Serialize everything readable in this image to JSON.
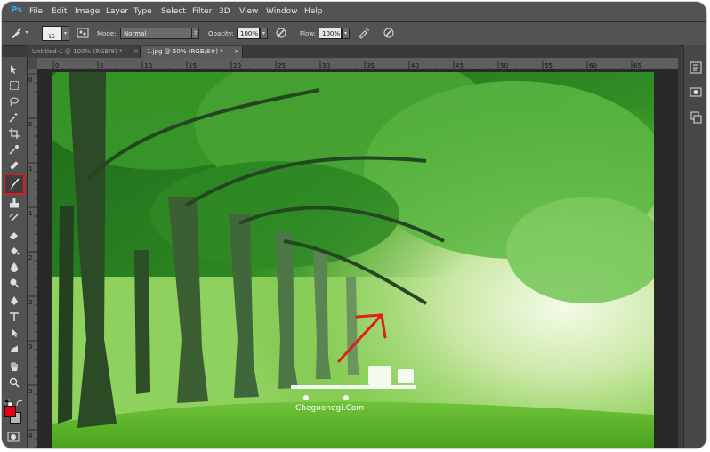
{
  "menubar": {
    "app_icon": "Ps",
    "items": [
      "File",
      "Edit",
      "Image",
      "Layer",
      "Type",
      "Select",
      "Filter",
      "3D",
      "View",
      "Window",
      "Help"
    ]
  },
  "options_bar": {
    "brush_size": "15",
    "mode_label": "Mode:",
    "mode_value": "Normal",
    "opacity_label": "Opacity:",
    "opacity_value": "100%",
    "flow_label": "Flow:",
    "flow_value": "100%"
  },
  "doc_tabs": [
    {
      "label": "Untitled-1 @ 100% (RGB/8) *",
      "active": false
    },
    {
      "label": "1.jpg @ 50% (RGB/8#) *",
      "active": true
    }
  ],
  "ruler": {
    "top_ticks": [
      "0",
      "5",
      "10",
      "15",
      "20",
      "25",
      "30",
      "35",
      "40",
      "45",
      "50",
      "55",
      "60",
      "65"
    ],
    "left_ticks": [
      "0",
      "5",
      "1",
      "1",
      "2",
      "2",
      "3",
      "3",
      "4"
    ]
  },
  "tools": [
    {
      "name": "move-tool",
      "icon": "move-icon"
    },
    {
      "name": "marquee-tool",
      "icon": "marquee-icon"
    },
    {
      "name": "lasso-tool",
      "icon": "lasso-icon"
    },
    {
      "name": "quick-select-tool",
      "icon": "magic-wand-icon"
    },
    {
      "name": "crop-tool",
      "icon": "crop-icon"
    },
    {
      "name": "eyedropper-tool",
      "icon": "eyedropper-icon"
    },
    {
      "name": "healing-brush-tool",
      "icon": "bandage-icon"
    },
    {
      "name": "brush-tool",
      "icon": "brush-icon",
      "selected": true
    },
    {
      "name": "clone-stamp-tool",
      "icon": "stamp-icon"
    },
    {
      "name": "history-brush-tool",
      "icon": "history-brush-icon"
    },
    {
      "name": "eraser-tool",
      "icon": "eraser-icon"
    },
    {
      "name": "paint-bucket-tool",
      "icon": "bucket-icon"
    },
    {
      "name": "blur-tool",
      "icon": "drop-icon"
    },
    {
      "name": "dodge-tool",
      "icon": "dodge-icon"
    },
    {
      "name": "pen-tool",
      "icon": "pen-icon"
    },
    {
      "name": "type-tool",
      "icon": "type-icon"
    },
    {
      "name": "path-select-tool",
      "icon": "arrow-icon"
    },
    {
      "name": "shape-tool",
      "icon": "shape-icon"
    },
    {
      "name": "hand-tool",
      "icon": "hand-icon"
    },
    {
      "name": "zoom-tool",
      "icon": "zoom-icon"
    }
  ],
  "colors": {
    "foreground": "#e5000f",
    "background": "#b8b8b8",
    "highlight": "#e8171c",
    "arrow": "#e21b1b"
  },
  "watermark": {
    "url_text": "Chegoonegi.Com"
  }
}
